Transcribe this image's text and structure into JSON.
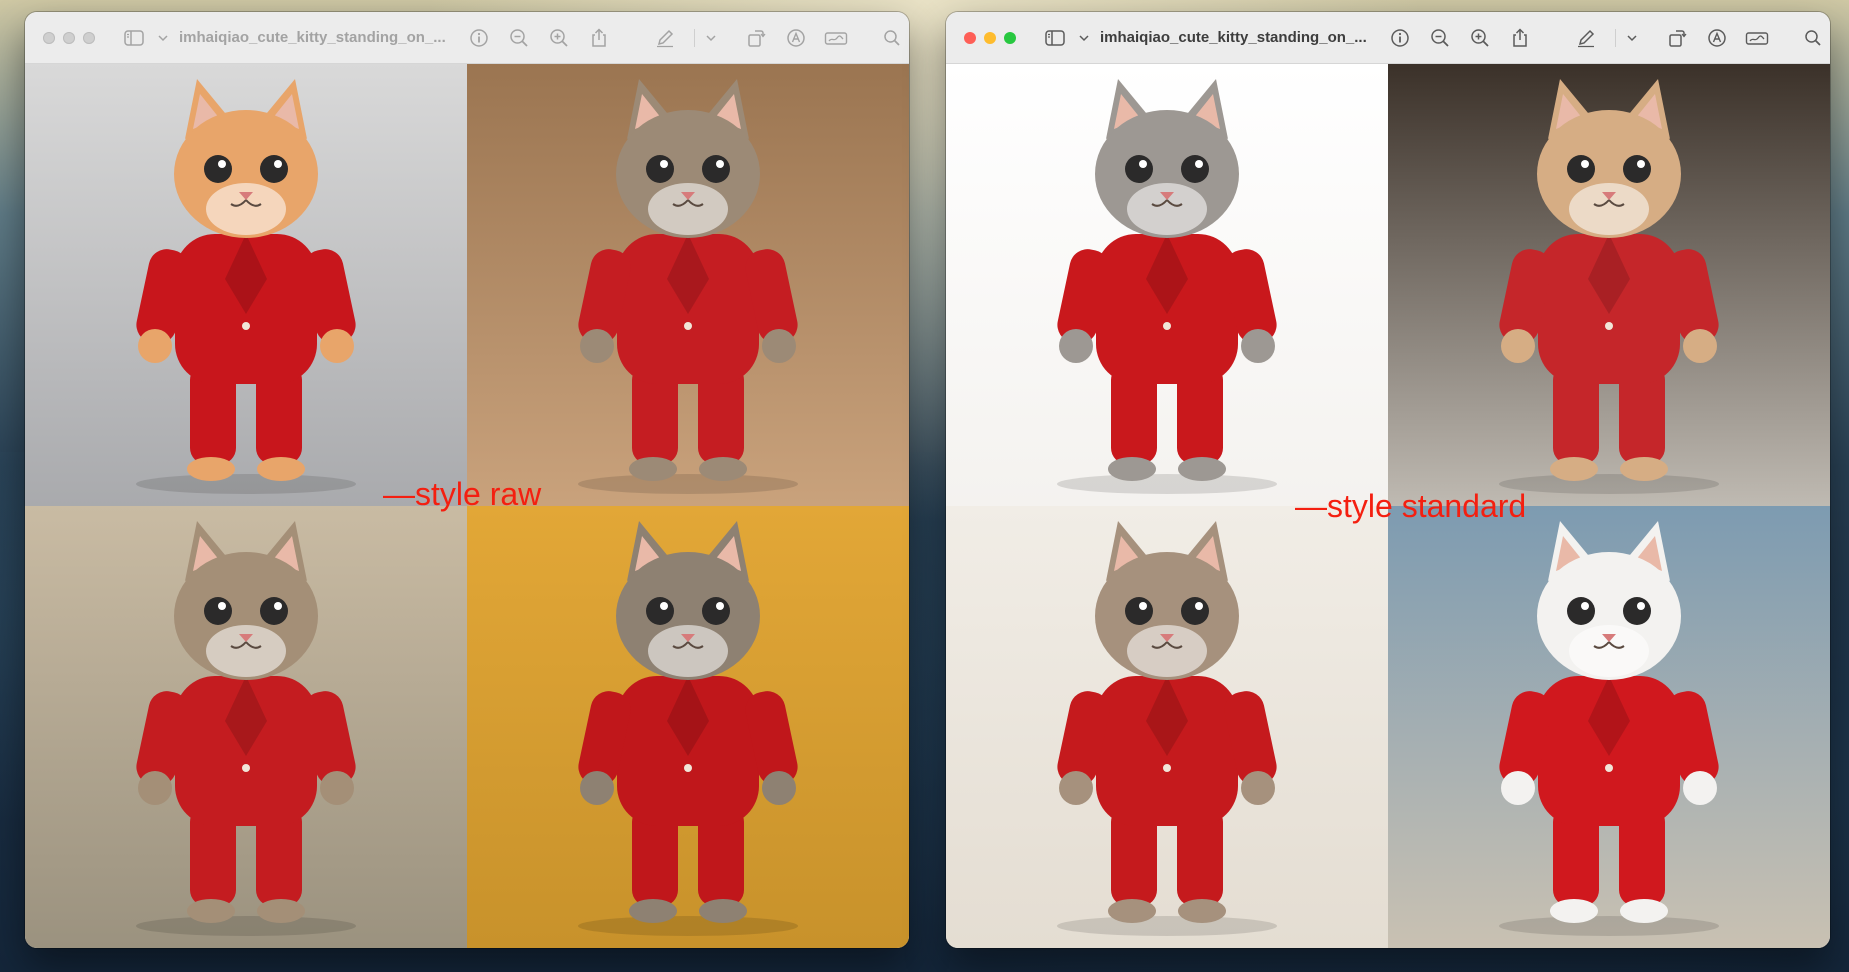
{
  "windows": [
    {
      "id": "left",
      "title": "imhaiqiao_cute_kitty_standing_on_...",
      "active": false,
      "overlay_label": "—style raw",
      "tiles": [
        {
          "bg_top": "#d9d9d9",
          "bg_bottom": "#a9aaad",
          "fur": "#e8a56a",
          "suit": "#c8161c"
        },
        {
          "bg_top": "#9b7551",
          "bg_bottom": "#c9a27c",
          "fur": "#9c8a76",
          "suit": "#c51d22"
        },
        {
          "bg_top": "#c9bba3",
          "bg_bottom": "#9b927f",
          "fur": "#a48f77",
          "suit": "#c41c20"
        },
        {
          "bg_top": "#e2a737",
          "bg_bottom": "#c8922b",
          "fur": "#8e8172",
          "suit": "#c0171b"
        }
      ]
    },
    {
      "id": "right",
      "title": "imhaiqiao_cute_kitty_standing_on_...",
      "active": true,
      "overlay_label": "—style standard",
      "tiles": [
        {
          "bg_top": "#ffffff",
          "bg_bottom": "#f4f2ef",
          "fur": "#9d9893",
          "suit": "#c9181c"
        },
        {
          "bg_top": "#3b3129",
          "bg_bottom": "#bfbab2",
          "fur": "#d6ad84",
          "suit": "#c5262a"
        },
        {
          "bg_top": "#f1ede6",
          "bg_bottom": "#e4ddd2",
          "fur": "#a6917d",
          "suit": "#c51a1d"
        },
        {
          "bg_top": "#7d9bb1",
          "bg_bottom": "#c9c1b2",
          "fur": "#f3f2f0",
          "suit": "#d0181e"
        }
      ]
    }
  ],
  "toolbar_icons": [
    "sidebar-icon",
    "chevron-down-icon",
    "info-icon",
    "zoom-out-icon",
    "zoom-in-icon",
    "share-icon",
    "markup-pen-icon",
    "chevron-down-icon",
    "rotate-icon",
    "markup-circle-icon",
    "sign-icon",
    "search-icon"
  ],
  "colors": {
    "overlay_label": "#f41f10"
  }
}
